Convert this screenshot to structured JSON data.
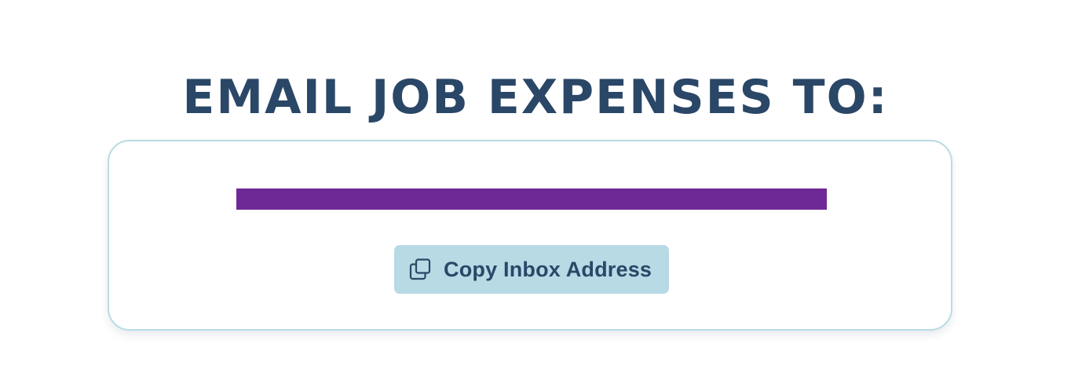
{
  "heading": "EMAIL JOB EXPENSES TO:",
  "inbox": {
    "address": "",
    "address_redacted": true
  },
  "copy_button": {
    "label": "Copy Inbox Address",
    "icon": "copy-icon"
  },
  "colors": {
    "heading_text": "#2a4767",
    "card_border": "#b9dbe4",
    "button_background": "#b7dae5",
    "redaction": "#6f2996"
  }
}
